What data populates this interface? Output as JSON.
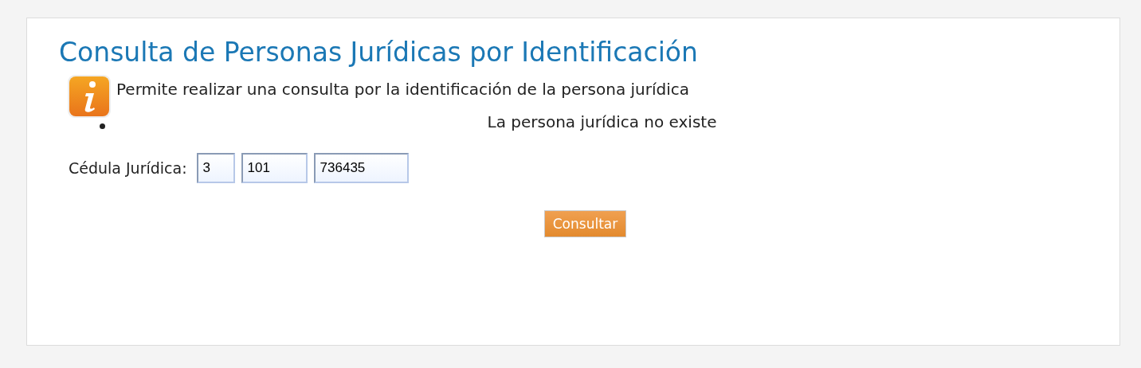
{
  "title": "Consulta de Personas Jurídicas por Identificación",
  "info": "Permite realizar una consulta por la identificación de la persona jurídica",
  "messages": [
    "La persona jurídica no existe"
  ],
  "form": {
    "label": "Cédula Jurídica:",
    "fields": [
      {
        "value": "3"
      },
      {
        "value": "101"
      },
      {
        "value": "736435"
      }
    ]
  },
  "button": "Consultar"
}
